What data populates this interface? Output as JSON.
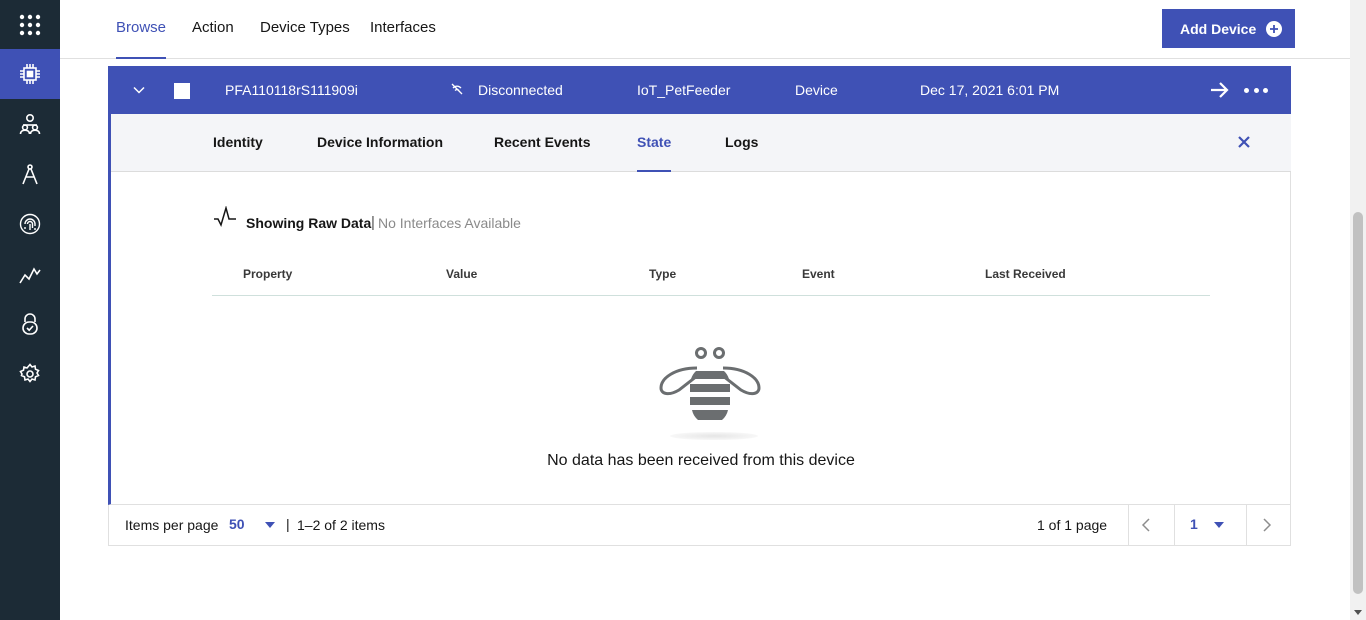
{
  "sidebar": {
    "items": [
      {
        "icon": "apps-grid-icon"
      },
      {
        "icon": "chip-icon",
        "active": true
      },
      {
        "icon": "members-icon"
      },
      {
        "icon": "compass-icon"
      },
      {
        "icon": "fingerprint-icon"
      },
      {
        "icon": "analytics-icon"
      },
      {
        "icon": "security-lock-icon"
      },
      {
        "icon": "settings-gear-icon"
      }
    ]
  },
  "topnav": {
    "tabs": [
      "Browse",
      "Action",
      "Device Types",
      "Interfaces"
    ],
    "active_tab": "Browse",
    "add_device_label": "Add Device"
  },
  "device_row": {
    "device_id": "PFA110118rS111909i",
    "status": "Disconnected",
    "device_type": "IoT_PetFeeder",
    "class": "Device",
    "date_added": "Dec 17, 2021 6:01 PM"
  },
  "detail_tabs": {
    "tabs": [
      "Identity",
      "Device Information",
      "Recent Events",
      "State",
      "Logs"
    ],
    "active_tab": "State"
  },
  "state": {
    "title": "Showing Raw Data",
    "separator": "|",
    "subtitle": "No Interfaces Available",
    "columns": [
      "Property",
      "Value",
      "Type",
      "Event",
      "Last Received"
    ],
    "empty_message": "No data has been received from this device"
  },
  "pagination": {
    "items_per_page_label": "Items per page",
    "items_per_page": "50",
    "separator": "|",
    "range_text": "1–2 of 2 items",
    "page_info": "1 of 1 page",
    "current_page": "1"
  },
  "colors": {
    "accent": "#3f51b5",
    "sidebar_bg": "#1c2b36",
    "panel_tab_bg": "#f4f5f8"
  }
}
